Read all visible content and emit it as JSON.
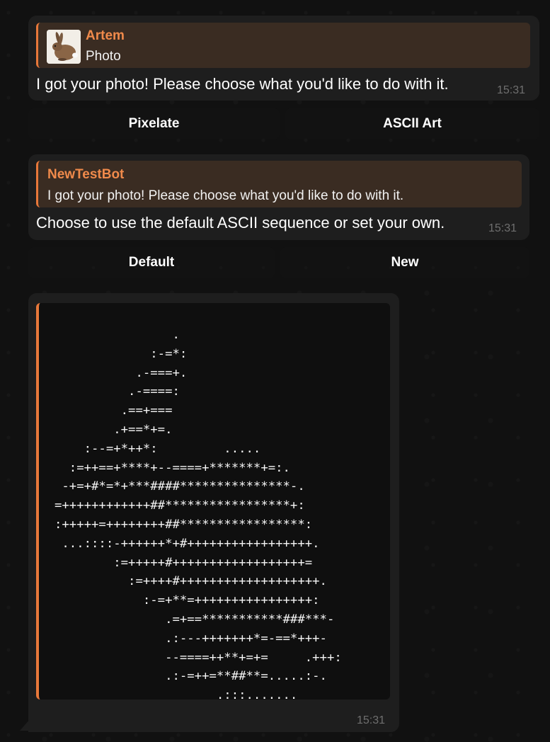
{
  "messages": [
    {
      "reply_name": "Artem",
      "reply_text": "Photo",
      "text": "I got your photo! Please choose what you'd like to do with it.",
      "time": "15:31",
      "buttons": [
        "Pixelate",
        "ASCII Art"
      ]
    },
    {
      "reply_name": "NewTestBot",
      "reply_text": "I got your photo! Please choose what you'd like to do with it.",
      "text": "Choose to use the default ASCII sequence or set your own.",
      "time": "15:31",
      "buttons": [
        "Default",
        "New"
      ]
    },
    {
      "ascii": "                .\n             :-=*:\n           .-===+.\n          .-====:\n         .==+===\n        .+==*+=.\n    :--=+*++*:         .....\n  :=++==+****+--====+*******+=:.\n -+=+#*=*+***####***************-.\n=++++++++++++##*****************+:\n:+++++=++++++++##*****************:\n ...::::-++++++*+#+++++++++++++++++.\n        :=+++++#++++++++++++++++++=\n          :=++++#+++++++++++++++++++.\n            :-=+**=++++++++++++++++:\n               .=+==***********###***-\n               .:---+++++++*=-==*+++-\n               --====++**+=+=     .+++:\n               .:-=++=**##**=.....:-.\n                      .:::.......",
      "time": "15:31"
    }
  ]
}
